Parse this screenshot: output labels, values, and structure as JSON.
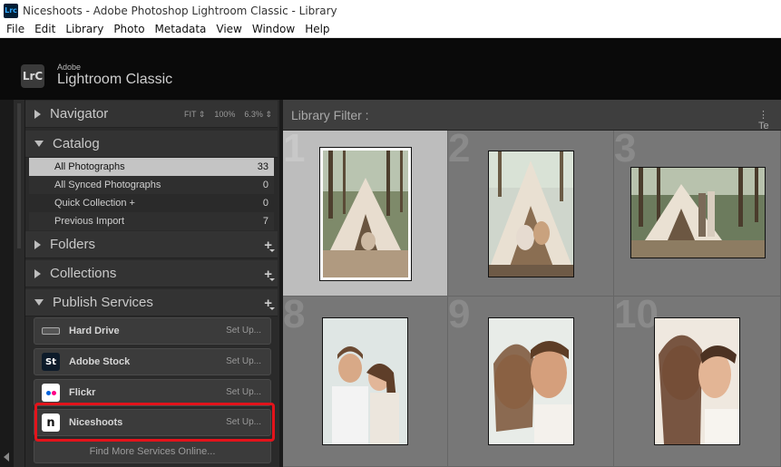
{
  "window": {
    "title": "Niceshoots - Adobe Photoshop Lightroom Classic - Library",
    "app_icon": "Lrc"
  },
  "menu": [
    "File",
    "Edit",
    "Library",
    "Photo",
    "Metadata",
    "View",
    "Window",
    "Help"
  ],
  "identity": {
    "logo": "LrC",
    "small": "Adobe",
    "name": "Lightroom Classic"
  },
  "navigator": {
    "label": "Navigator",
    "fit": "FIT",
    "zoom1": "100%",
    "zoom2": "6.3%"
  },
  "catalog": {
    "label": "Catalog",
    "items": [
      {
        "label": "All Photographs",
        "count": "33"
      },
      {
        "label": "All Synced Photographs",
        "count": "0"
      },
      {
        "label": "Quick Collection  +",
        "count": "0"
      },
      {
        "label": "Previous Import",
        "count": "7"
      }
    ]
  },
  "folders": {
    "label": "Folders"
  },
  "collections": {
    "label": "Collections"
  },
  "publish": {
    "label": "Publish Services",
    "services": [
      {
        "label": "Hard Drive",
        "action": "Set Up...",
        "icon": "hard-drive-icon"
      },
      {
        "label": "Adobe Stock",
        "action": "Set Up...",
        "icon": "adobe-stock-icon",
        "icon_text": "St"
      },
      {
        "label": "Flickr",
        "action": "Set Up...",
        "icon": "flickr-icon"
      },
      {
        "label": "Niceshoots",
        "action": "Set Up...",
        "icon": "niceshoots-icon",
        "icon_text": "n"
      }
    ],
    "find_more": "Find More Services Online..."
  },
  "filter": {
    "label": "Library Filter :",
    "right_text": "Te"
  },
  "grid": {
    "cells": [
      {
        "num": "1",
        "selected": true
      },
      {
        "num": "2",
        "selected": false
      },
      {
        "num": "3",
        "selected": false
      },
      {
        "num": "8",
        "selected": false
      },
      {
        "num": "9",
        "selected": false
      },
      {
        "num": "10",
        "selected": false
      }
    ]
  },
  "colors": {
    "accent_highlight": "#e3131b",
    "panel_bg": "#2a2a2a",
    "grid_cell": "#777777",
    "selected_cell": "#bdbdbd"
  }
}
